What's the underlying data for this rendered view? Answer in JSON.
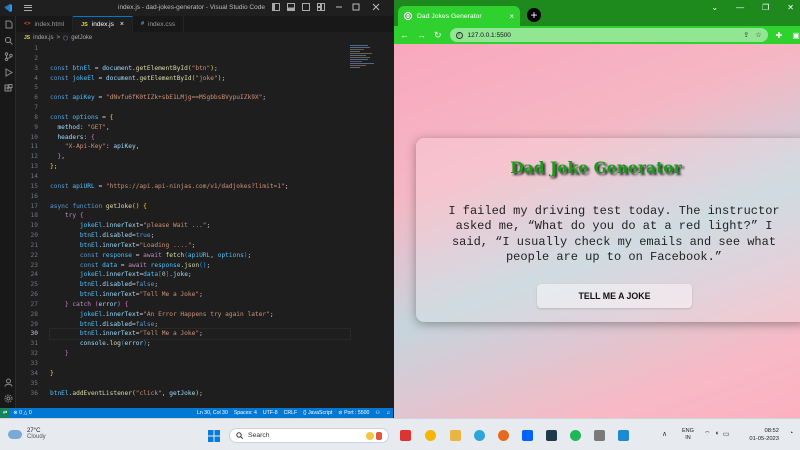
{
  "vscode": {
    "title": "index.js - dad-jokes-generator - Visual Studio Code",
    "tabs": [
      {
        "ext": "<>",
        "label": "index.html",
        "active": false,
        "color": "#e44d26"
      },
      {
        "ext": "JS",
        "label": "index.js",
        "active": true,
        "color": "#e8d44d"
      },
      {
        "ext": "#",
        "label": "index.css",
        "active": false,
        "color": "#4fa3e0"
      }
    ],
    "breadcrumb": {
      "file": "index.js",
      "sep": ">",
      "symbol": "getJoke"
    },
    "active_line": 30,
    "code_lines": [
      [],
      [],
      [
        [
          "kw",
          "const "
        ],
        [
          "var",
          "btnEl"
        ],
        [
          "pun",
          " = "
        ],
        [
          "id",
          "document"
        ],
        [
          "pun",
          "."
        ],
        [
          "fn",
          "getElementById"
        ],
        [
          "br1",
          "("
        ],
        [
          "str",
          "\"btn\""
        ],
        [
          "br1",
          ")"
        ],
        [
          "pun",
          ";"
        ]
      ],
      [
        [
          "kw",
          "const "
        ],
        [
          "var",
          "jokeEl"
        ],
        [
          "pun",
          " = "
        ],
        [
          "id",
          "document"
        ],
        [
          "pun",
          "."
        ],
        [
          "fn",
          "getElementById"
        ],
        [
          "br1",
          "("
        ],
        [
          "str",
          "\"joke\""
        ],
        [
          "br1",
          ")"
        ],
        [
          "pun",
          ";"
        ]
      ],
      [],
      [
        [
          "kw",
          "const "
        ],
        [
          "var",
          "apiKey"
        ],
        [
          "pun",
          " = "
        ],
        [
          "str",
          "\"dNvfu6fK0tIZk+sbE1LMjg==MSgbbsBVypuIZk9X\""
        ],
        [
          "pun",
          ";"
        ]
      ],
      [],
      [
        [
          "kw",
          "const "
        ],
        [
          "var",
          "options"
        ],
        [
          "pun",
          " = "
        ],
        [
          "br1",
          "{"
        ]
      ],
      [
        [
          "pun",
          "  "
        ],
        [
          "id",
          "method"
        ],
        [
          "pun",
          ": "
        ],
        [
          "str",
          "\"GET\""
        ],
        [
          "pun",
          ","
        ]
      ],
      [
        [
          "pun",
          "  "
        ],
        [
          "id",
          "headers"
        ],
        [
          "pun",
          ": "
        ],
        [
          "br2",
          "{"
        ]
      ],
      [
        [
          "pun",
          "    "
        ],
        [
          "str",
          "\"X-Api-Key\""
        ],
        [
          "pun",
          ": "
        ],
        [
          "id",
          "apiKey"
        ],
        [
          "pun",
          ","
        ]
      ],
      [
        [
          "pun",
          "  "
        ],
        [
          "br2",
          "}"
        ],
        [
          "pun",
          ","
        ]
      ],
      [
        [
          "br1",
          "}"
        ],
        [
          "pun",
          ";"
        ]
      ],
      [],
      [
        [
          "kw",
          "const "
        ],
        [
          "var",
          "apiURL"
        ],
        [
          "pun",
          " = "
        ],
        [
          "str",
          "\"https://api.api-ninjas.com/v1/dadjokes?limit=1\""
        ],
        [
          "pun",
          ";"
        ]
      ],
      [],
      [
        [
          "kw",
          "async "
        ],
        [
          "kw",
          "function "
        ],
        [
          "fn",
          "getJoke"
        ],
        [
          "br1",
          "()"
        ],
        [
          "pun",
          " "
        ],
        [
          "br1",
          "{"
        ]
      ],
      [
        [
          "pun",
          "    "
        ],
        [
          "ctl",
          "try "
        ],
        [
          "br2",
          "{"
        ]
      ],
      [
        [
          "pun",
          "        "
        ],
        [
          "var",
          "jokeEl"
        ],
        [
          "pun",
          "."
        ],
        [
          "id",
          "innerText"
        ],
        [
          "pun",
          "="
        ],
        [
          "str",
          "\"please Wait ...\""
        ],
        [
          "pun",
          ";"
        ]
      ],
      [
        [
          "pun",
          "        "
        ],
        [
          "var",
          "btnEl"
        ],
        [
          "pun",
          "."
        ],
        [
          "id",
          "disabled"
        ],
        [
          "pun",
          "="
        ],
        [
          "kw",
          "true"
        ],
        [
          "pun",
          ";"
        ]
      ],
      [
        [
          "pun",
          "        "
        ],
        [
          "var",
          "btnEl"
        ],
        [
          "pun",
          "."
        ],
        [
          "id",
          "innerText"
        ],
        [
          "pun",
          "="
        ],
        [
          "str",
          "\"Loading ....\""
        ],
        [
          "pun",
          ";"
        ]
      ],
      [
        [
          "pun",
          "        "
        ],
        [
          "kw",
          "const "
        ],
        [
          "var",
          "response"
        ],
        [
          "pun",
          " = "
        ],
        [
          "ctl",
          "await "
        ],
        [
          "fn",
          "fetch"
        ],
        [
          "br3",
          "("
        ],
        [
          "var",
          "apiURL"
        ],
        [
          "pun",
          ", "
        ],
        [
          "var",
          "options"
        ],
        [
          "br3",
          ")"
        ],
        [
          "pun",
          ";"
        ]
      ],
      [
        [
          "pun",
          "        "
        ],
        [
          "kw",
          "const "
        ],
        [
          "var",
          "data"
        ],
        [
          "pun",
          " = "
        ],
        [
          "ctl",
          "await "
        ],
        [
          "var",
          "response"
        ],
        [
          "pun",
          "."
        ],
        [
          "fn",
          "json"
        ],
        [
          "br3",
          "()"
        ],
        [
          "pun",
          ";"
        ]
      ],
      [
        [
          "pun",
          "        "
        ],
        [
          "var",
          "jokeEl"
        ],
        [
          "pun",
          "."
        ],
        [
          "id",
          "innerText"
        ],
        [
          "pun",
          "="
        ],
        [
          "var",
          "data"
        ],
        [
          "br3",
          "["
        ],
        [
          "num",
          "0"
        ],
        [
          "br3",
          "]"
        ],
        [
          "pun",
          "."
        ],
        [
          "id",
          "joke"
        ],
        [
          "pun",
          ";"
        ]
      ],
      [
        [
          "pun",
          "        "
        ],
        [
          "var",
          "btnEl"
        ],
        [
          "pun",
          "."
        ],
        [
          "id",
          "disabled"
        ],
        [
          "pun",
          "="
        ],
        [
          "kw",
          "false"
        ],
        [
          "pun",
          ";"
        ]
      ],
      [
        [
          "pun",
          "        "
        ],
        [
          "var",
          "btnEl"
        ],
        [
          "pun",
          "."
        ],
        [
          "id",
          "innerText"
        ],
        [
          "pun",
          "="
        ],
        [
          "str",
          "\"Tell Me a Joke\""
        ],
        [
          "pun",
          ";"
        ]
      ],
      [
        [
          "pun",
          "    "
        ],
        [
          "br2",
          "}"
        ],
        [
          "pun",
          " "
        ],
        [
          "ctl",
          "catch "
        ],
        [
          "br2",
          "("
        ],
        [
          "id",
          "error"
        ],
        [
          "br2",
          ")"
        ],
        [
          "pun",
          " "
        ],
        [
          "br2",
          "{"
        ]
      ],
      [
        [
          "pun",
          "        "
        ],
        [
          "var",
          "jokeEl"
        ],
        [
          "pun",
          "."
        ],
        [
          "id",
          "innerText"
        ],
        [
          "pun",
          "="
        ],
        [
          "str",
          "\"An Error Happens try again later\""
        ],
        [
          "pun",
          ";"
        ]
      ],
      [
        [
          "pun",
          "        "
        ],
        [
          "var",
          "btnEl"
        ],
        [
          "pun",
          "."
        ],
        [
          "id",
          "disabled"
        ],
        [
          "pun",
          "="
        ],
        [
          "kw",
          "false"
        ],
        [
          "pun",
          ";"
        ]
      ],
      [
        [
          "pun",
          "        "
        ],
        [
          "var",
          "btnEl"
        ],
        [
          "pun",
          "."
        ],
        [
          "id",
          "innerText"
        ],
        [
          "pun",
          "="
        ],
        [
          "str",
          "\"Tell Me a Joke\""
        ],
        [
          "pun",
          ";"
        ]
      ],
      [
        [
          "pun",
          "        "
        ],
        [
          "id",
          "console"
        ],
        [
          "pun",
          "."
        ],
        [
          "fn",
          "log"
        ],
        [
          "br3",
          "("
        ],
        [
          "id",
          "error"
        ],
        [
          "br3",
          ")"
        ],
        [
          "pun",
          ";"
        ]
      ],
      [
        [
          "pun",
          "    "
        ],
        [
          "br2",
          "}"
        ]
      ],
      [],
      [
        [
          "br1",
          "}"
        ]
      ],
      [],
      [
        [
          "var",
          "btnEl"
        ],
        [
          "pun",
          "."
        ],
        [
          "fn",
          "addEventListener"
        ],
        [
          "br1",
          "("
        ],
        [
          "str",
          "\"click\""
        ],
        [
          "pun",
          ", "
        ],
        [
          "id",
          "getJoke"
        ],
        [
          "br1",
          ")"
        ],
        [
          "pun",
          ";"
        ]
      ]
    ],
    "status": {
      "errors": "⊗ 0 △ 0",
      "cursor": "Ln 30, Col 30",
      "spaces": "Spaces: 4",
      "encoding": "UTF-8",
      "eol": "CRLF",
      "language": "{} JavaScript",
      "port": "⊘ Port : 5500"
    }
  },
  "browser": {
    "tab_title": "Dad Jokes Generator",
    "url": "127.0.0.1:5500",
    "page": {
      "title": "Dad Joke Generator",
      "joke": "I failed my driving test today. The instructor asked me, “What do you do at a red light?” I said, “I usually check my emails and see what people are up to on Facebook.”",
      "button": "TELL ME A JOKE"
    }
  },
  "taskbar": {
    "weather_temp": "27°C",
    "weather_desc": "Cloudy",
    "search_placeholder": "Search",
    "lang_1": "ENG",
    "lang_2": "IN",
    "time": "08:52",
    "date": "01-05-2023"
  }
}
